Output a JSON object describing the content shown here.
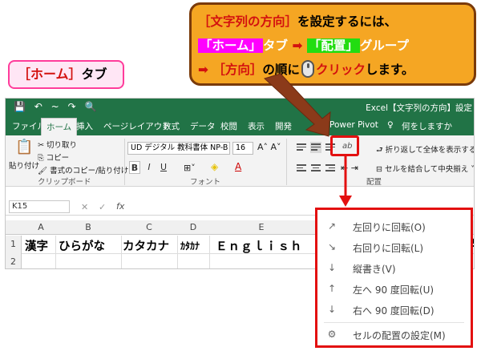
{
  "callout_main": {
    "line1_a": "［文字列の方向］",
    "line1_b": "を設定するには、",
    "line2_a": "「ホーム」",
    "line2_b": "タブ",
    "line2_arrow": "➡",
    "line2_c": "「配置」",
    "line2_d": "グループ",
    "line3_arrow": "➡",
    "line3_a": "［方向］",
    "line3_b": "の順に",
    "line3_c": "クリック",
    "line3_d": "します。"
  },
  "callout_home": {
    "bracket": "［ホーム］",
    "suffix": "タブ"
  },
  "excel": {
    "window_title": "Excel【文字列の方向】設定",
    "qat": [
      "💾",
      "↶",
      "~",
      "↷",
      "🔍"
    ],
    "tabs": [
      "ファイル",
      "ホーム",
      "挿入",
      "ページレイアウト",
      "数式",
      "データ",
      "校閲",
      "表示",
      "開発",
      "Power Pivot",
      "♀",
      "何をしますか"
    ],
    "ribbon": {
      "paste": "貼り付け",
      "cut": "切り取り",
      "copy": "コピー",
      "format_painter": "書式のコピー/貼り付け",
      "clipboard_group": "クリップボード",
      "font_name": "UD デジタル 教科書体 NP-B",
      "font_size": "16",
      "bold": "B",
      "italic": "I",
      "underline": "U",
      "font_group": "フォント",
      "wrap_text": "折り返して全体を表示する",
      "merge_center": "セルを結合して中央揃え",
      "alignment_group": "配置",
      "orientation_icon": "ab"
    },
    "name_box": "K15",
    "fx": "fx",
    "columns": [
      "A",
      "B",
      "C",
      "D",
      "E"
    ],
    "rows": [
      "1",
      "2"
    ],
    "row1": [
      "漢字",
      "ひらがな",
      "カタカナ",
      "ｶﾀｶﾅ",
      "Ｅｎｇｌｉｓｈ"
    ],
    "row1_tail": "2"
  },
  "orientation_menu": {
    "items": [
      {
        "icon": "counterclockwise-icon",
        "label": "左回りに回転(O)"
      },
      {
        "icon": "clockwise-icon",
        "label": "右回りに回転(L)"
      },
      {
        "icon": "vertical-text-icon",
        "label": "縦書き(V)"
      },
      {
        "icon": "rotate-up-icon",
        "label": "左へ 90 度回転(U)"
      },
      {
        "icon": "rotate-down-icon",
        "label": "右へ 90 度回転(D)"
      },
      {
        "icon": "format-alignment-icon",
        "label": "セルの配置の設定(M)"
      }
    ]
  },
  "colors": {
    "excel_green": "#217346",
    "highlight_red": "#e31010",
    "callout_orange": "#f5a623",
    "arrow_brown": "#8b3a1a"
  }
}
